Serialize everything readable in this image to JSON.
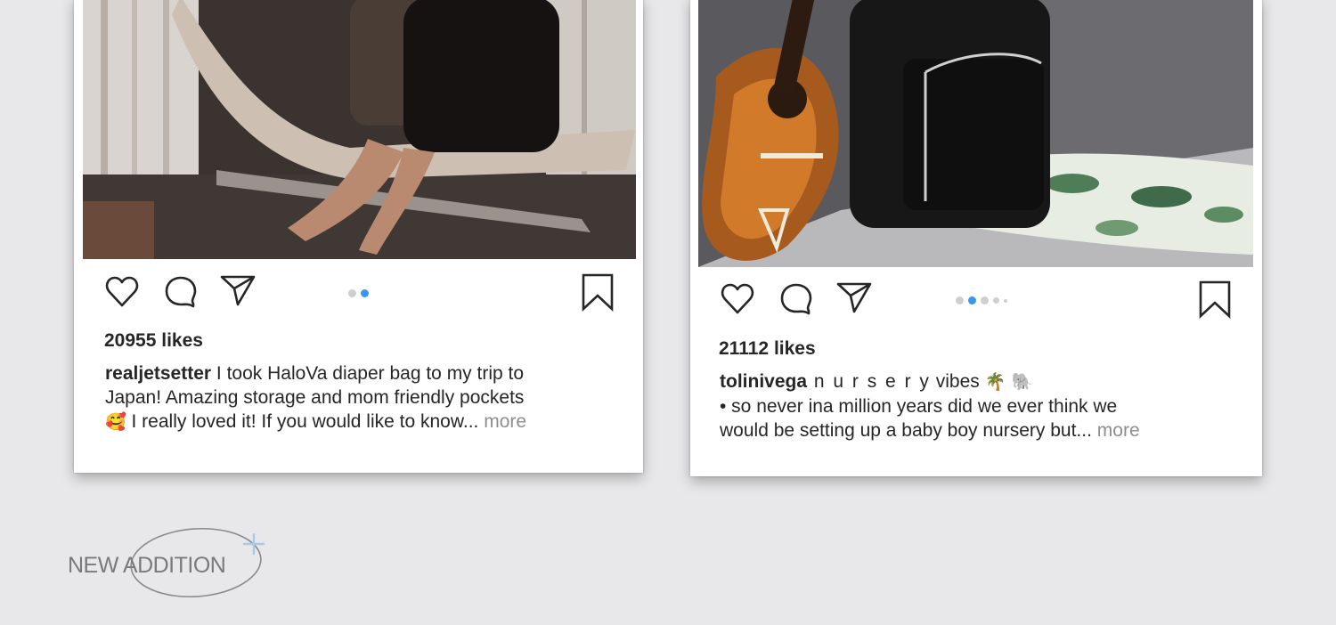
{
  "posts": [
    {
      "likes_count": "20955",
      "likes_suffix": "likes",
      "username": "realjetsetter",
      "caption_line1": " I took HaloVa diaper bag to my trip to",
      "caption_line2": "Japan! Amazing storage and mom friendly pockets",
      "caption_emoji": "🥰",
      "caption_line3": " I really loved it! If you would like to know...",
      "more_label": " more",
      "carousel": {
        "count": 2,
        "active": 1
      },
      "photo_icon": "woman-with-diaper-bag-photo"
    },
    {
      "likes_count": "21112",
      "likes_suffix": "likes",
      "username": "tolinivega",
      "caption_spaced": " n u r s e r y",
      "caption_after": " vibes",
      "caption_emojis": " 🌴 🐘",
      "caption_line2": "• so never ina million years did we ever think we",
      "caption_line3": "would be setting up a baby boy nursery but...",
      "more_label": " more",
      "carousel": {
        "count": 5,
        "active": 1
      },
      "photo_icon": "ukulele-and-diaper-bag-photo"
    }
  ],
  "badge": {
    "label": "NEW ADDITION"
  },
  "colors": {
    "background": "#e8e8ea",
    "card": "#ffffff",
    "active_dot": "#3897f0",
    "text": "#262626",
    "muted": "#8e8e8e"
  }
}
